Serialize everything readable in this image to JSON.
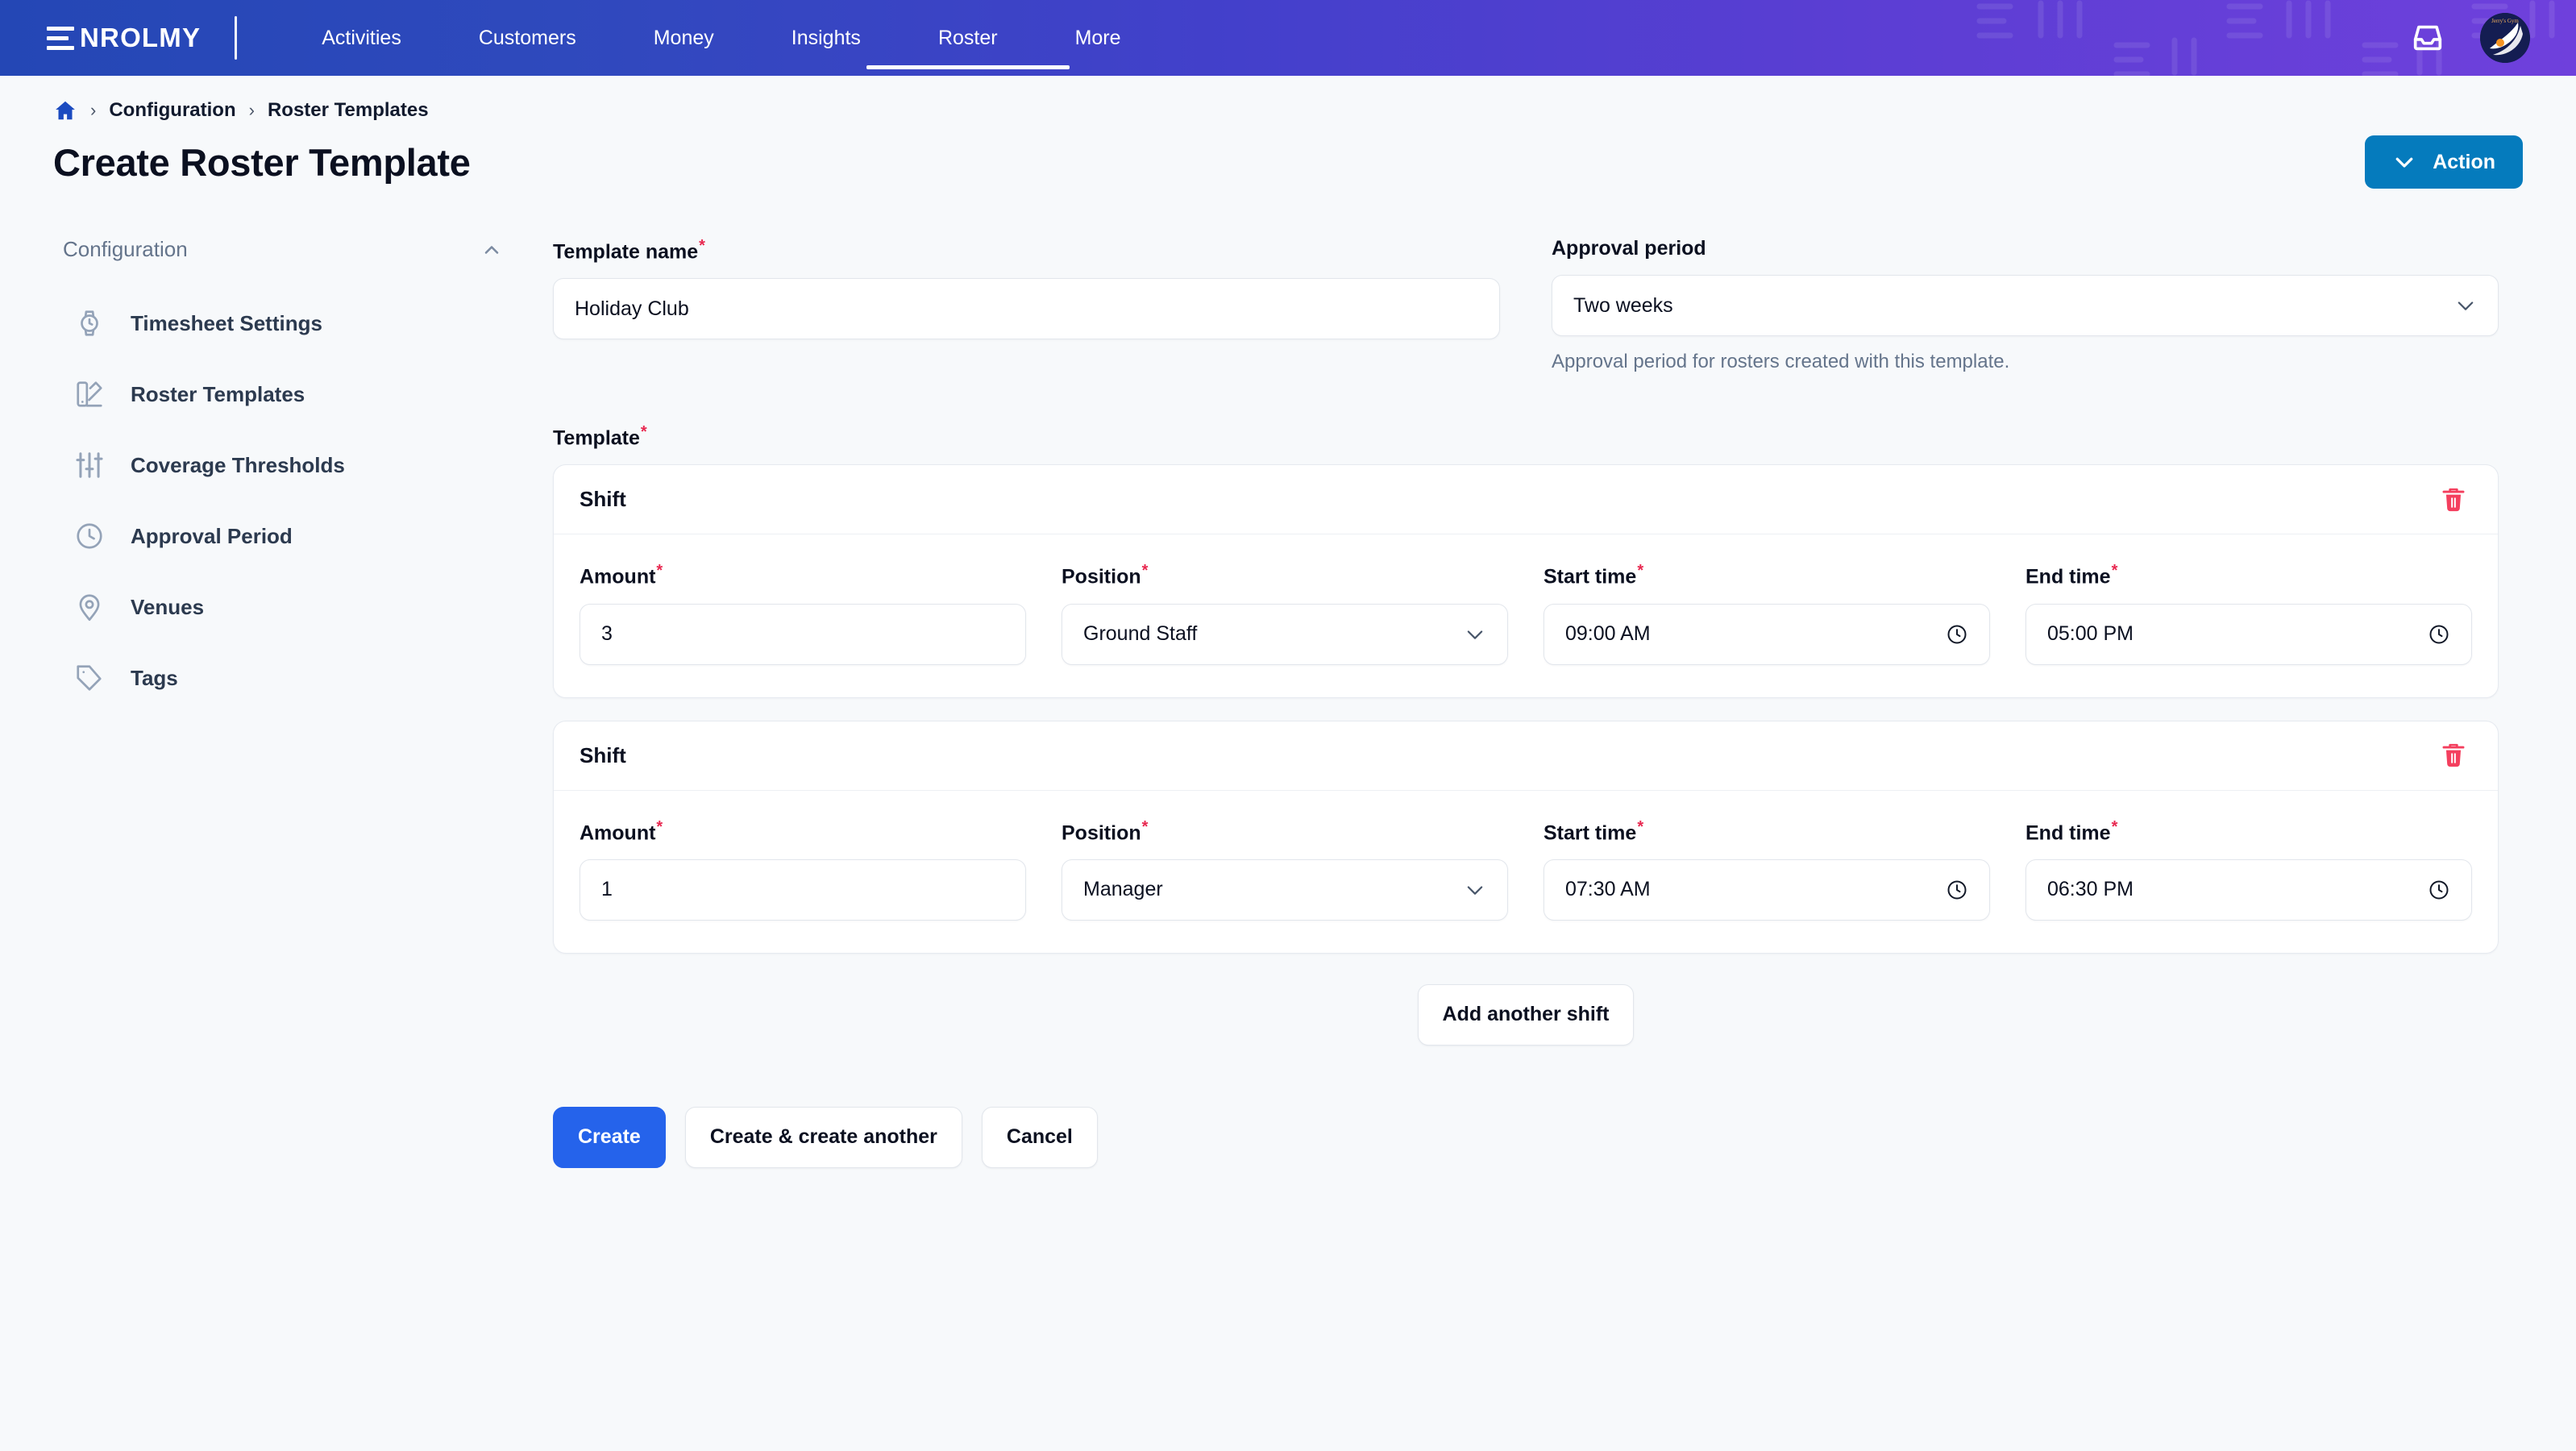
{
  "nav": {
    "logo": "NROLMY",
    "logo_icon": "enrolmy-e-icon",
    "items": [
      {
        "label": "Activities",
        "active": false
      },
      {
        "label": "Customers",
        "active": false
      },
      {
        "label": "Money",
        "active": false
      },
      {
        "label": "Insights",
        "active": false
      },
      {
        "label": "Roster",
        "active": true
      },
      {
        "label": "More",
        "active": false
      }
    ],
    "inbox_icon": "inbox-icon",
    "avatar_icon": "account-avatar"
  },
  "breadcrumb": {
    "home_icon": "home-icon",
    "items": [
      "Configuration",
      "Roster Templates"
    ],
    "separator": "›"
  },
  "header": {
    "title": "Create Roster Template",
    "action_label": "Action",
    "action_icon": "chevron-down-icon"
  },
  "sidebar": {
    "heading": "Configuration",
    "collapse_icon": "chevron-up-icon",
    "items": [
      {
        "label": "Timesheet Settings",
        "icon": "watch-icon"
      },
      {
        "label": "Roster Templates",
        "icon": "template-swatch-icon"
      },
      {
        "label": "Coverage Thresholds",
        "icon": "sliders-icon"
      },
      {
        "label": "Approval Period",
        "icon": "clock-icon"
      },
      {
        "label": "Venues",
        "icon": "map-pin-icon"
      },
      {
        "label": "Tags",
        "icon": "tag-icon"
      }
    ]
  },
  "form": {
    "template_name": {
      "label": "Template name",
      "required": true,
      "value": "Holiday Club",
      "placeholder": ""
    },
    "approval_period": {
      "label": "Approval period",
      "required": false,
      "value": "Two weeks",
      "helper": "Approval period for rosters created with this template.",
      "chevron_icon": "chevron-down-icon"
    },
    "template": {
      "label": "Template",
      "required": true
    },
    "field_labels": {
      "amount": "Amount",
      "position": "Position",
      "start_time": "Start time",
      "end_time": "End time",
      "shift": "Shift"
    },
    "shifts": [
      {
        "title": "Shift",
        "amount": "3",
        "position": "Ground Staff",
        "start_time": "09:00 AM",
        "end_time": "05:00 PM",
        "delete_icon": "trash-icon"
      },
      {
        "title": "Shift",
        "amount": "1",
        "position": "Manager",
        "start_time": "07:30 AM",
        "end_time": "06:30 PM",
        "delete_icon": "trash-icon"
      }
    ],
    "add_shift_label": "Add another shift",
    "buttons": {
      "create": "Create",
      "create_another": "Create & create another",
      "cancel": "Cancel"
    },
    "required_marker": "*"
  },
  "colors": {
    "nav_gradient_start": "#2447b5",
    "nav_gradient_end": "#6f40dc",
    "action_button": "#057bbd",
    "primary_button": "#2563eb",
    "required_asterisk": "#e8274f",
    "delete_icon": "#f43f5e",
    "page_background": "#f7f9fb",
    "home_icon": "#1b4bc0"
  }
}
